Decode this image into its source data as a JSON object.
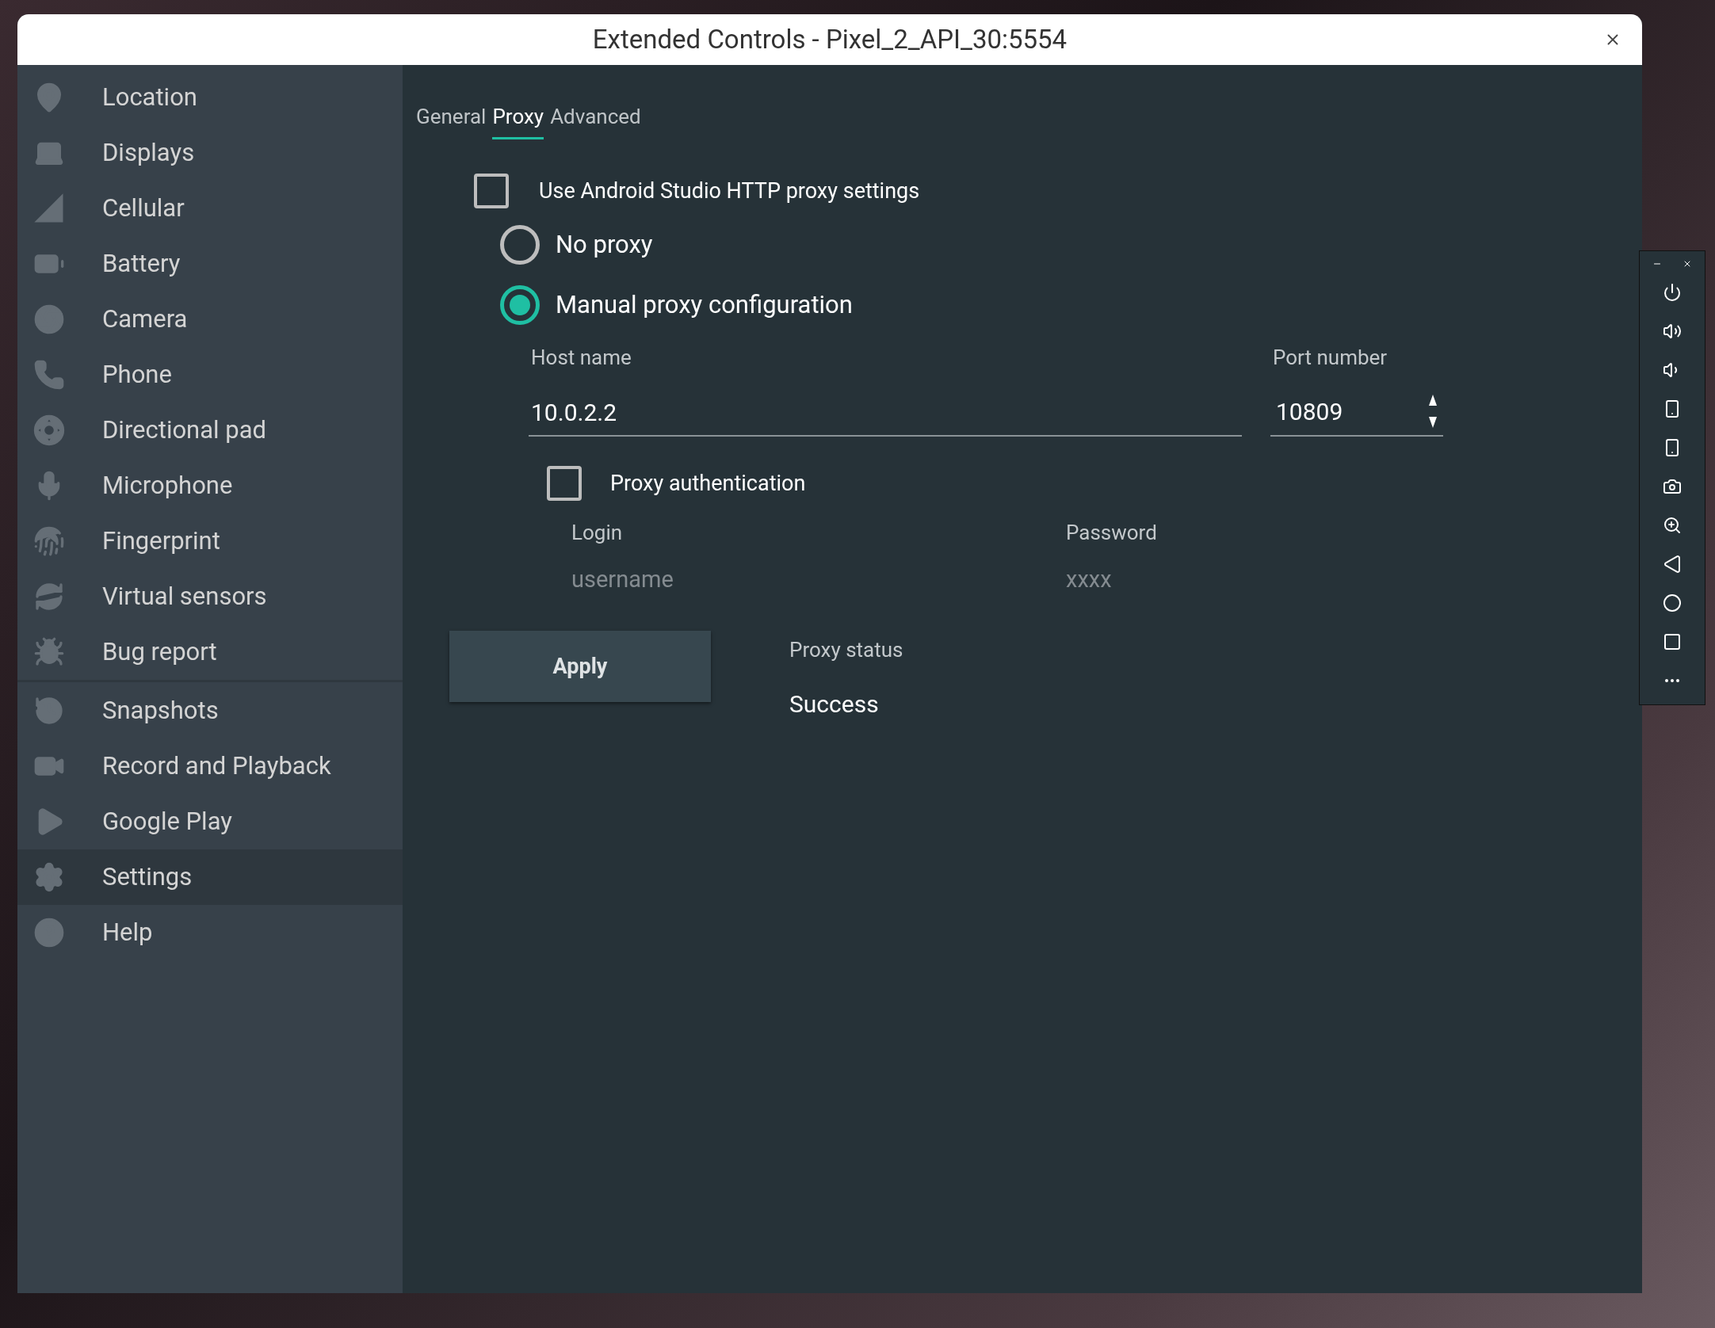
{
  "window": {
    "title": "Extended Controls - Pixel_2_API_30:5554"
  },
  "sidebar": {
    "groups": [
      {
        "items": [
          {
            "label": "Location",
            "selected": false
          },
          {
            "label": "Displays",
            "selected": false
          },
          {
            "label": "Cellular",
            "selected": false
          },
          {
            "label": "Battery",
            "selected": false
          },
          {
            "label": "Camera",
            "selected": false
          },
          {
            "label": "Phone",
            "selected": false
          },
          {
            "label": "Directional pad",
            "selected": false
          },
          {
            "label": "Microphone",
            "selected": false
          },
          {
            "label": "Fingerprint",
            "selected": false
          },
          {
            "label": "Virtual sensors",
            "selected": false
          },
          {
            "label": "Bug report",
            "selected": false
          }
        ]
      },
      {
        "items": [
          {
            "label": "Snapshots",
            "selected": false
          },
          {
            "label": "Record and Playback",
            "selected": false
          },
          {
            "label": "Google Play",
            "selected": false
          }
        ]
      },
      {
        "items": [
          {
            "label": "Settings",
            "selected": true
          },
          {
            "label": "Help",
            "selected": false
          }
        ]
      }
    ]
  },
  "tabs": [
    {
      "label": "General",
      "selected": false
    },
    {
      "label": "Proxy",
      "selected": true
    },
    {
      "label": "Advanced",
      "selected": false
    }
  ],
  "proxy": {
    "studio_checkbox": {
      "label": "Use Android Studio HTTP proxy settings",
      "checked": false
    },
    "options": [
      {
        "label": "No proxy",
        "selected": false
      },
      {
        "label": "Manual proxy configuration",
        "selected": true
      }
    ],
    "host": {
      "label": "Host name",
      "value": "10.0.2.2"
    },
    "port": {
      "label": "Port number",
      "value": "10809"
    },
    "auth_checkbox": {
      "label": "Proxy authentication",
      "checked": false
    },
    "login": {
      "label": "Login",
      "placeholder": "username"
    },
    "password": {
      "label": "Password",
      "placeholder": "xxxx"
    },
    "apply_button": "Apply",
    "status": {
      "label": "Proxy status",
      "value": "Success"
    }
  }
}
